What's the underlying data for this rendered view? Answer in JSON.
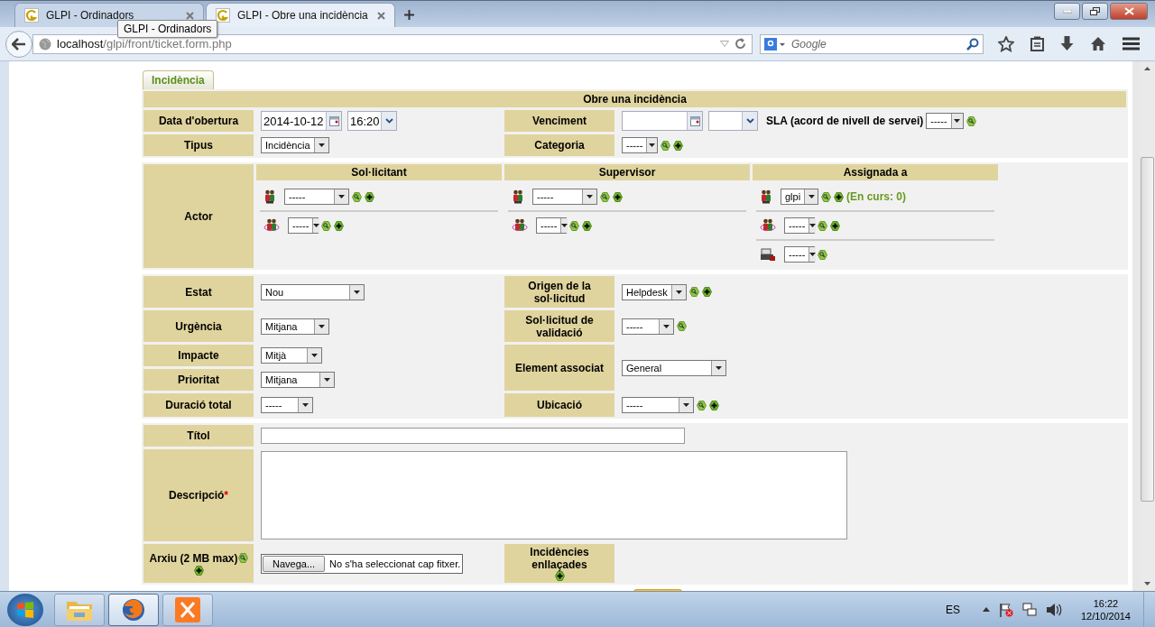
{
  "browser": {
    "tabs": [
      {
        "title": "GLPI - Ordinadors",
        "selected": false
      },
      {
        "title": "GLPI - Obre una incidència",
        "selected": true
      }
    ],
    "tooltip": "GLPI - Ordinadors",
    "address": {
      "host": "localhost",
      "path": "/glpi/front/ticket.form.php"
    },
    "search": {
      "placeholder": "Google"
    }
  },
  "form_tabs": [
    {
      "label": "Incidència",
      "selected": true
    }
  ],
  "header": "Obre una incidència",
  "opening": {
    "label": "Data d'obertura",
    "date": "2014-10-12",
    "time": "16:20"
  },
  "due": {
    "label": "Venciment",
    "sla_label": "SLA (acord de nivell de servei)",
    "sla_value": "-----"
  },
  "type": {
    "label": "Tipus",
    "value": "Incidència"
  },
  "category": {
    "label": "Categoria",
    "value": "-----"
  },
  "actors": {
    "label": "Actor",
    "columns": [
      {
        "title": "Sol·licitant",
        "rows": [
          {
            "kind": "user",
            "value": "-----",
            "add": true
          },
          {
            "kind": "group",
            "value": "-----",
            "add": true
          }
        ]
      },
      {
        "title": "Supervisor",
        "rows": [
          {
            "kind": "user",
            "value": "-----",
            "add": true
          },
          {
            "kind": "group",
            "value": "-----",
            "add": true
          }
        ]
      },
      {
        "title": "Assignada a",
        "rows": [
          {
            "kind": "user",
            "value": "glpi",
            "add": true,
            "note": "(En curs: 0)"
          },
          {
            "kind": "group",
            "value": "-----",
            "add": true
          },
          {
            "kind": "supplier",
            "value": "-----",
            "add": false
          }
        ]
      }
    ]
  },
  "status_fields": {
    "left": [
      {
        "label": "Estat",
        "value": "Nou"
      },
      {
        "label": "Urgència",
        "value": "Mitjana"
      },
      {
        "label": "Impacte",
        "value": "Mitjà"
      },
      {
        "label": "Prioritat",
        "value": "Mitjana"
      },
      {
        "label": "Duració total",
        "value": "-----"
      }
    ],
    "right": [
      {
        "label": "Origen de la sol·licitud",
        "value": "Helpdesk",
        "search": true,
        "add": true
      },
      {
        "label": "Sol·licitud de validació",
        "value": "-----",
        "search": true,
        "add": false
      },
      {
        "label": "Element associat",
        "value": "General",
        "search": false,
        "add": false
      },
      {
        "label": "Ubicació",
        "value": "-----",
        "search": true,
        "add": true
      }
    ]
  },
  "title_field": {
    "label": "Títol"
  },
  "description": {
    "label": "Descripció",
    "required_mark": "*"
  },
  "attachment": {
    "label": "Arxiu (2 MB max)",
    "button": "Navega...",
    "status": "No s'ha seleccionat cap fitxer."
  },
  "linked": {
    "label": "Incidències enllaçades"
  },
  "taskbar": {
    "apps": [
      {
        "kind": "explorer",
        "selected": false
      },
      {
        "kind": "firefox",
        "selected": true
      },
      {
        "kind": "xampp",
        "selected": false
      }
    ],
    "language": "ES",
    "time": "16:22",
    "date": "12/10/2014"
  }
}
